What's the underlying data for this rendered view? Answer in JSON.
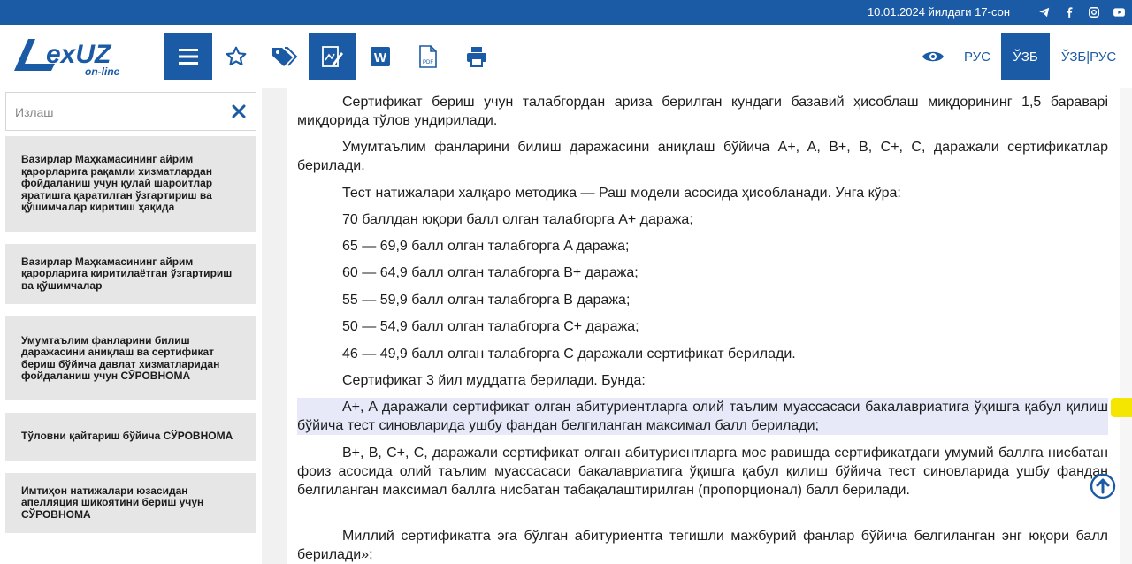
{
  "topbar": {
    "date_label": "10.01.2024 йилдаги 17-сон",
    "social": [
      "telegram-icon",
      "facebook-icon",
      "instagram-icon",
      "youtube-icon"
    ]
  },
  "header": {
    "logo": {
      "brand": "LexUZ",
      "tagline": "on-line"
    },
    "toolbar": [
      "menu-icon",
      "star-icon",
      "tags-icon",
      "edit-document-icon",
      "word-icon",
      "pdf-icon",
      "print-icon"
    ],
    "languages": [
      "РУС",
      "ЎЗБ",
      "ЎЗБ|РУС"
    ],
    "active_language": "ЎЗБ"
  },
  "sidebar": {
    "search_placeholder": "Излаш",
    "items": [
      "Вазирлар Маҳкамасининг айрим қарорларига рақамли хизматлардан фойдаланиш учун қулай шароитлар яратишга қаратилган ўзгартириш ва қўшимчалар киритиш ҳақида",
      "Вазирлар Маҳкамасининг айрим қарорларига киритилаётган ўзгартириш ва қўшимчалар",
      "Умумтаълим фанларини билиш даражасини аниқлаш ва сертификат бериш бўйича давлат хизматларидан фойдаланиш учун СЎРОВНОМА",
      "Тўловни қайтариш бўйича СЎРОВНОМА",
      "Имтиҳон натижалари юзасидан апелляция шикоятини бериш учун СЎРОВНОМА"
    ]
  },
  "document": {
    "paragraphs": [
      "Сертификат бериш учун талабгордан ариза берилган кундаги базавий ҳисоблаш миқдорининг 1,5 бараварi миқдорида тўлов ундирилади.",
      "Умумтаълим фанларини билиш даражасини аниқлаш бўйича A+, A, B+, B, C+, C, даражали сертификатлар берилади.",
      "Тест натижалари халқаро методика — Раш модели асосида ҳисобланади. Унга кўра:",
      "70 баллдан юқори балл олган талабгорга A+ даража;",
      "65 — 69,9 балл олган талабгорга A даража;",
      "60 — 64,9 балл олган талабгорга B+ даража;",
      "55 — 59,9 балл олган талабгорга B даража;",
      "50 — 54,9 балл олган талабгорга C+ даража;",
      "46 — 49,9 балл олган талабгорга C даражали сертификат берилади.",
      "Сертификат 3 йил муддатга берилади. Бунда:",
      "A+, A даражали сертификат олган абитуриентларга олий таълим муассасаси бакалавриатига ўқишга қабул қилиш бўйича тест синовларида ушбу фандан белгиланган максимал балл берилади;",
      "B+, B, C+, C, даражали сертификат олган абитуриентларга мос равишда сертификатдаги умумий баллга нисбатан фоиз асосида олий таълим муассасаси бакалавриатига ўқишга қабул қилиш бўйича тест синовларида ушбу фандан белгиланган максимал баллга нисбатан табақалаштирилган (пропорционал) балл берилади.",
      "Миллий сертификатга эга бўлган абитуриентга тегишли мажбурий фанлар бўйича белгиланган энг юқори балл берилади»;"
    ]
  },
  "colors": {
    "brand": "#1b5aa5",
    "highlight": "#e7e9f9",
    "note_flag": "#f4e600"
  }
}
